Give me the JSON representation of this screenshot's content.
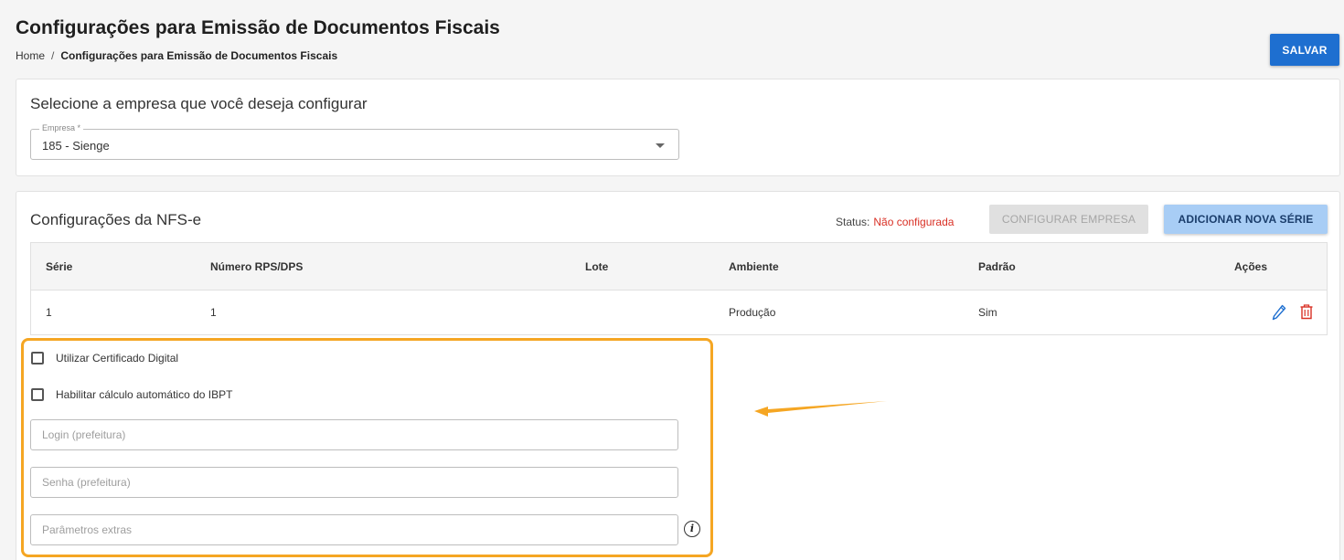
{
  "page": {
    "title": "Configurações para Emissão de Documentos Fiscais",
    "breadcrumb": {
      "home": "Home",
      "separator": "/",
      "current": "Configurações para Emissão de Documentos Fiscais"
    },
    "save_label": "SALVAR"
  },
  "company_card": {
    "title": "Selecione a empresa que você deseja configurar",
    "field_label": "Empresa *",
    "field_value": "185 - Sienge"
  },
  "nfse_card": {
    "title": "Configurações da NFS-e",
    "status_label": "Status:",
    "status_value": "Não configurada",
    "configure_label": "CONFIGURAR EMPRESA",
    "add_series_label": "ADICIONAR NOVA SÉRIE",
    "table": {
      "headers": [
        "Série",
        "Número RPS/DPS",
        "Lote",
        "Ambiente",
        "Padrão",
        "Ações"
      ],
      "rows": [
        {
          "serie": "1",
          "numero": "1",
          "lote": "",
          "ambiente": "Produção",
          "padrao": "Sim"
        }
      ]
    },
    "options": {
      "certificado_label": "Utilizar Certificado Digital",
      "ibpt_label": "Habilitar cálculo automático do IBPT"
    },
    "fields": {
      "login_placeholder": "Login (prefeitura)",
      "senha_placeholder": "Senha (prefeitura)",
      "parametros_placeholder": "Parâmetros extras"
    }
  },
  "icons": {
    "edit": "pencil-icon",
    "delete": "trash-icon",
    "info": "info-icon",
    "dropdown": "caret-down-icon"
  },
  "colors": {
    "primary": "#1e6fd0",
    "status_error": "#d93025",
    "highlight": "#f5a623"
  }
}
